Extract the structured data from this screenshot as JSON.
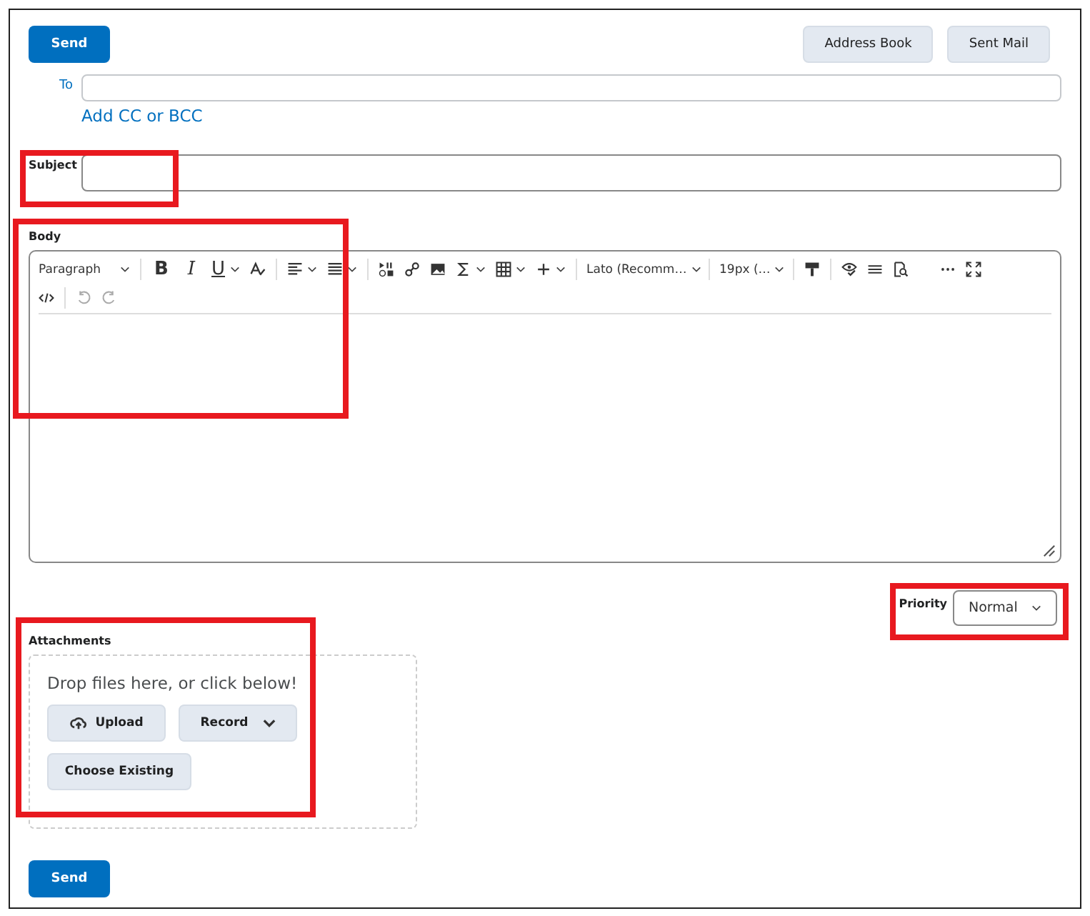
{
  "top_buttons": {
    "send": "Send",
    "address_book": "Address Book",
    "sent_mail": "Sent Mail"
  },
  "to": {
    "label": "To",
    "add_cc": "Add CC or BCC"
  },
  "subject": {
    "label": "Subject"
  },
  "body": {
    "label": "Body",
    "toolbar": {
      "format": "Paragraph",
      "bold": "B",
      "italic": "I",
      "underline": "U",
      "font": "Lato (Recomm…",
      "size": "19px (…"
    }
  },
  "priority": {
    "label": "Priority",
    "value": "Normal"
  },
  "attachments": {
    "label": "Attachments",
    "hint": "Drop files here, or click below!",
    "upload": "Upload",
    "record": "Record",
    "choose": "Choose Existing"
  },
  "bottom_send": "Send"
}
